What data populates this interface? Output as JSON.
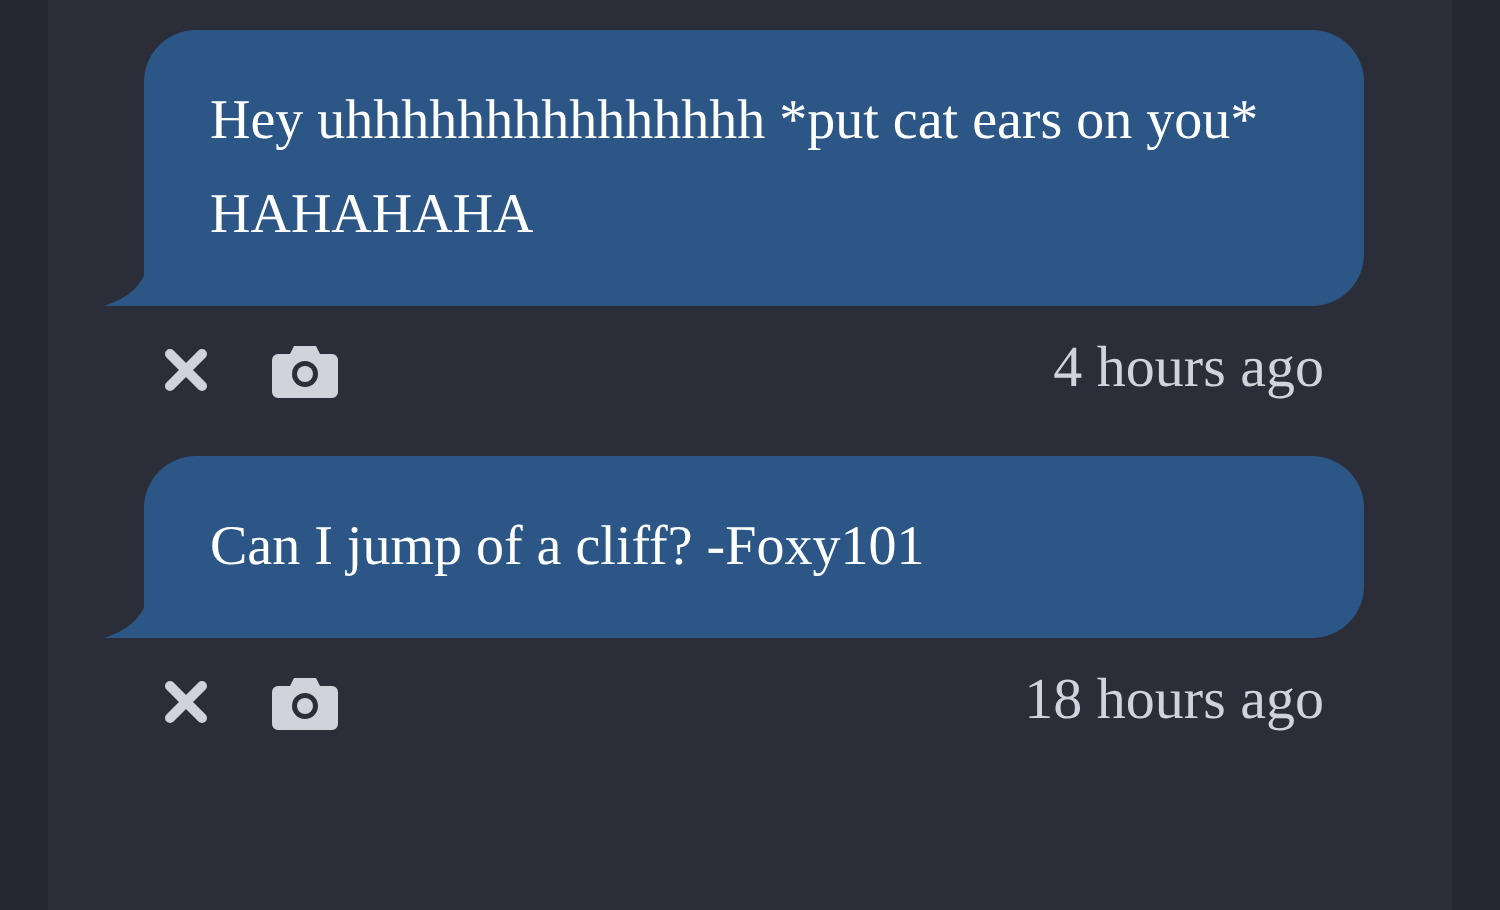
{
  "messages": [
    {
      "text": "Hey uhhhhhhhhhhhhhhh *put cat ears on you* HAHAHAHA",
      "time": "4 hours ago"
    },
    {
      "text": "Can I jump of a cliff? -Foxy101",
      "time": "18 hours ago"
    }
  ]
}
